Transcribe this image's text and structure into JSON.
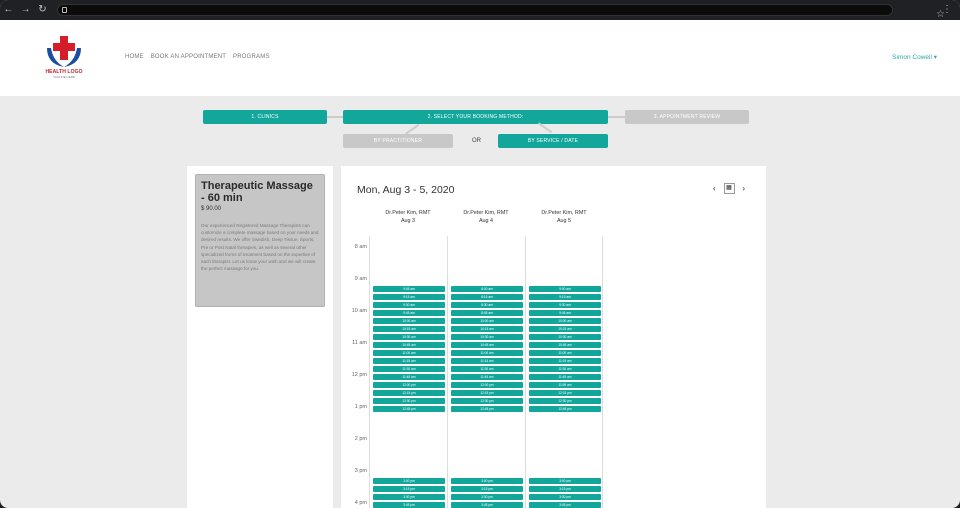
{
  "browser": {
    "url": ""
  },
  "header": {
    "logo_text": "HEALTH LOGO",
    "logo_tagline": "TAGLINE HERE",
    "nav": [
      "HOME",
      "BOOK AN APPOINTMENT",
      "PROGRAMS"
    ],
    "user": "Simon Cowell"
  },
  "steps": {
    "step1": "1. CLINICS",
    "step2": "2. SELECT YOUR BOOKING METHOD:",
    "step3": "3. APPOINTMENT REVIEW",
    "method_practitioner": "BY PRACTITIONER",
    "or": "OR",
    "method_service": "BY SERVICE / DATE"
  },
  "service": {
    "title": "Therapeutic Massage - 60 min",
    "price": "$ 90.00",
    "description": "Our experienced Registered Massage Therapists can customize a complete massage based on your needs and desired results. We offer Swedish, Deep Tissue, Sports, Pre or Post Natal therapies, as well as several other specialized forms of treatment based on the expertise of each therapist. Let us know your wish and we will create the perfect massage for you."
  },
  "calendar": {
    "title": "Mon, Aug 3 - 5, 2020",
    "hours": [
      "8 am",
      "9 am",
      "10 am",
      "11 am",
      "12 pm",
      "1 pm",
      "2 pm",
      "3 pm",
      "4 pm"
    ],
    "columns": [
      {
        "name": "Dr.Peter Kim, RMT",
        "date": "Aug 3",
        "slots_a": [
          "9:05 am",
          "9:15 am",
          "9:30 am",
          "9:45 am",
          "10:00 am",
          "10:15 am",
          "10:30 am",
          "10:45 am",
          "11:00 am",
          "11:15 am",
          "11:30 am",
          "11:45 am",
          "12:00 pm",
          "12:15 pm",
          "12:30 pm",
          "12:45 pm"
        ],
        "slots_b": [
          "3:00 pm",
          "3:15 pm",
          "3:30 pm",
          "3:45 pm"
        ]
      },
      {
        "name": "Dr.Peter Kim, RMT",
        "date": "Aug 4",
        "slots_a": [
          "8:00 am",
          "8:15 am",
          "8:30 am",
          "8:45 am",
          "10:00 am",
          "10:15 am",
          "10:30 am",
          "10:45 am",
          "11:00 am",
          "11:15 am",
          "11:30 am",
          "11:45 am",
          "12:00 pm",
          "12:15 pm",
          "12:30 pm",
          "12:45 pm"
        ],
        "slots_b": [
          "3:00 pm",
          "3:15 pm",
          "3:30 pm",
          "3:45 pm"
        ]
      },
      {
        "name": "Dr.Peter Kim, RMT",
        "date": "Aug 5",
        "slots_a": [
          "9:00 am",
          "9:15 am",
          "9:30 am",
          "9:45 am",
          "10:00 am",
          "10:15 am",
          "10:30 am",
          "10:45 am",
          "11:00 am",
          "11:15 am",
          "11:30 am",
          "11:45 am",
          "11:59 am",
          "12:15 pm",
          "12:30 pm",
          "12:45 pm"
        ],
        "slots_b": [
          "3:00 pm",
          "3:15 pm",
          "3:30 pm",
          "3:45 pm"
        ]
      }
    ]
  },
  "colors": {
    "accent": "#13a79c",
    "step_inactive": "#c8c8c8",
    "service_bg": "#c6c6c6"
  }
}
